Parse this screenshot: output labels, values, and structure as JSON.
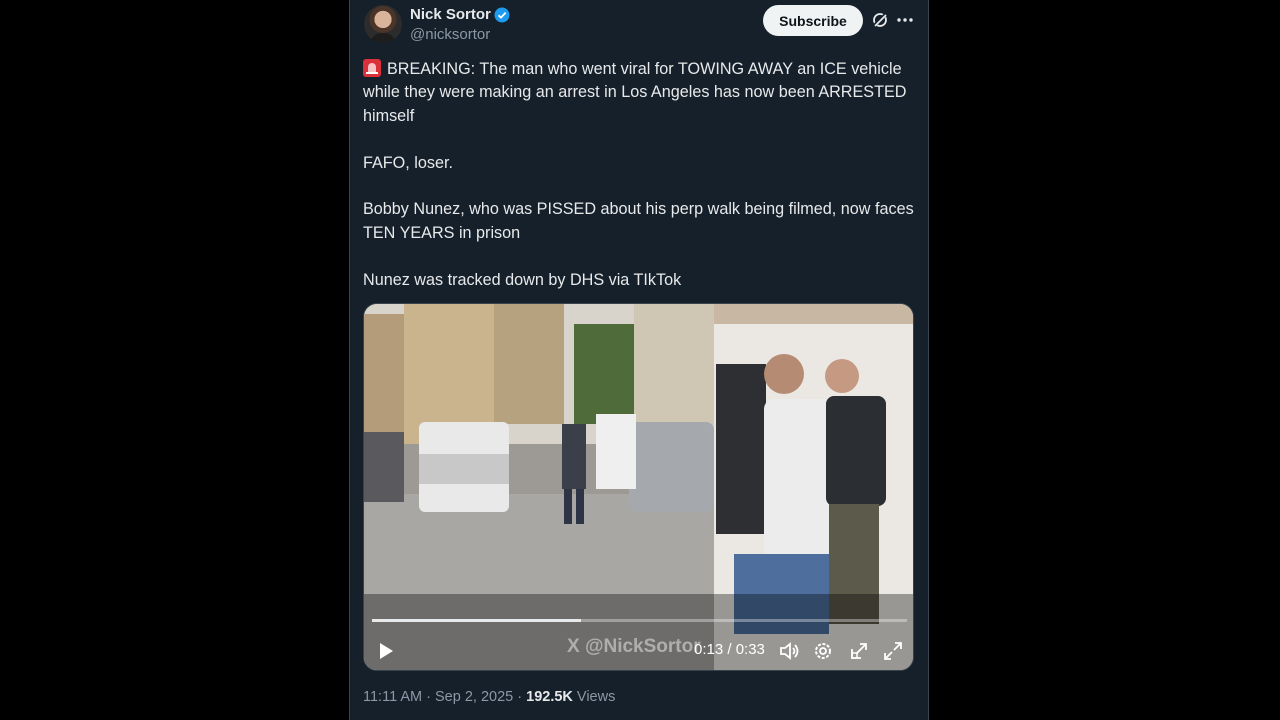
{
  "author": {
    "name": "Nick Sortor",
    "handle": "@nicksortor"
  },
  "header": {
    "subscribe_label": "Subscribe"
  },
  "tweet": {
    "paragraphs": [
      "BREAKING: The man who went viral for TOWING AWAY an ICE vehicle while they were making an arrest in Los Angeles has now been ARRESTED himself",
      "FAFO, loser.",
      "Bobby Nunez, who was PISSED about his perp walk being filmed, now faces TEN YEARS in prison",
      "Nunez was tracked down by DHS via TIkTok"
    ]
  },
  "video": {
    "watermark": "X @NickSortor",
    "time": "0:13 / 0:33",
    "progress": 0.39
  },
  "footer": {
    "time": "11:11 AM",
    "date": "Sep 2, 2025",
    "views_count": "192.5K",
    "views_label": "Views"
  },
  "colors": {
    "background": "#15202b",
    "text": "#e7e9ea",
    "secondary": "#8b98a5",
    "verified": "#1d9bf0",
    "siren": "#d9303a"
  },
  "icons": [
    "siren-emoji-icon",
    "verified-badge-icon",
    "grok-icon",
    "more-icon",
    "play-icon",
    "volume-icon",
    "settings-icon",
    "popout-icon",
    "fullscreen-icon"
  ]
}
